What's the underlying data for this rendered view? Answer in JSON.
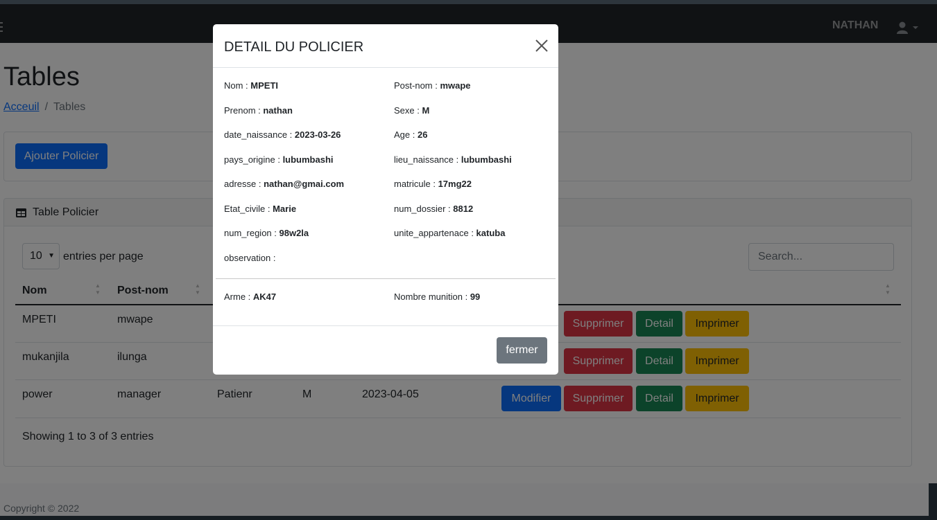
{
  "navbar": {
    "user_name": "NATHAN"
  },
  "page": {
    "title": "Tables"
  },
  "breadcrumb": {
    "home": "Acceuil",
    "separator": "/",
    "current": "Tables"
  },
  "actions": {
    "add_label": "Ajouter Policier"
  },
  "card": {
    "title": "Table Policier"
  },
  "datatable": {
    "per_page_value": "10",
    "per_page_label": "entries per page",
    "search_placeholder": "Search...",
    "columns": [
      "Nom",
      "Post-nom"
    ],
    "rows": [
      {
        "nom": "MPETI",
        "postnom": "mwape"
      },
      {
        "nom": "mukanjila",
        "postnom": "ilunga"
      },
      {
        "nom": "power",
        "postnom": "manager",
        "prenom": "Patienr",
        "sexe": "M",
        "date": "2023-04-05"
      }
    ],
    "buttons": {
      "modifier": "Modifier",
      "supprimer": "Supprimer",
      "detail": "Detail",
      "imprimer": "Imprimer"
    },
    "info": "Showing 1 to 3 of 3 entries"
  },
  "footer": {
    "copyright": "Copyright © 2022"
  },
  "modal": {
    "title": "DETAIL DU POLICIER",
    "fields": {
      "nom": {
        "label": "Nom : ",
        "value": "MPETI"
      },
      "postnom": {
        "label": "Post-nom : ",
        "value": "mwape"
      },
      "prenom": {
        "label": "Prenom : ",
        "value": "nathan"
      },
      "sexe": {
        "label": "Sexe : ",
        "value": "M"
      },
      "date_naissance": {
        "label": "date_naissance : ",
        "value": "2023-03-26"
      },
      "age": {
        "label": "Age : ",
        "value": "26"
      },
      "pays_origine": {
        "label": "pays_origine : ",
        "value": "lubumbashi"
      },
      "lieu_naissance": {
        "label": "lieu_naissance : ",
        "value": "lubumbashi"
      },
      "adresse": {
        "label": "adresse : ",
        "value": "nathan@gmai.com"
      },
      "matricule": {
        "label": "matricule : ",
        "value": "17mg22"
      },
      "etat_civile": {
        "label": "Etat_civile : ",
        "value": "Marie"
      },
      "num_dossier": {
        "label": "num_dossier : ",
        "value": "8812"
      },
      "num_region": {
        "label": "num_region : ",
        "value": "98w2la"
      },
      "unite_appartenace": {
        "label": "unite_appartenace : ",
        "value": "katuba"
      },
      "observation": {
        "label": "observation : ",
        "value": ""
      },
      "arme": {
        "label": "Arme : ",
        "value": "AK47"
      },
      "nombre_munition": {
        "label": "Nombre munition : ",
        "value": "99"
      }
    },
    "close_label": "fermer"
  },
  "colors": {
    "primary": "#0d6efd",
    "danger": "#dc3545",
    "success": "#198754",
    "warning": "#ffc107",
    "secondary": "#6c757d",
    "navbar": "#212529"
  }
}
